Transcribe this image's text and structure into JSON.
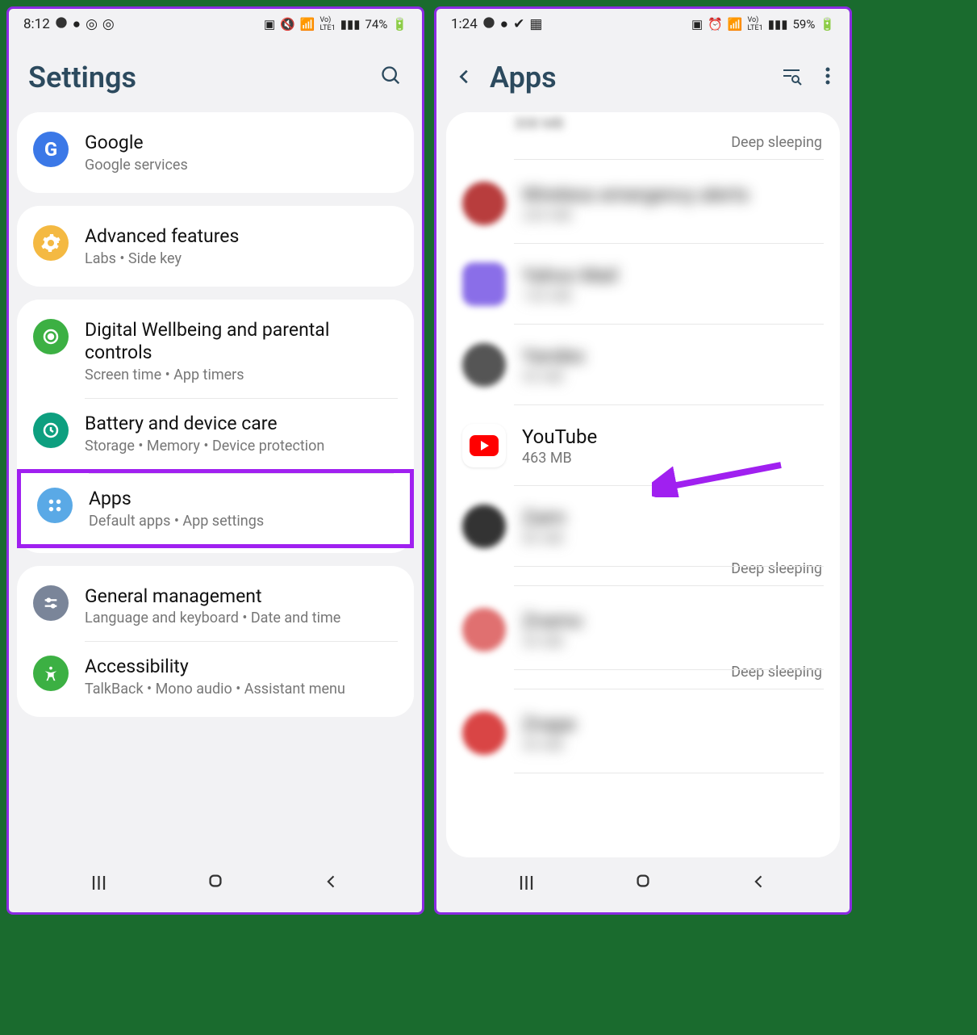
{
  "left": {
    "status": {
      "time": "8:12",
      "battery": "74%"
    },
    "title": "Settings",
    "groups": [
      {
        "items": [
          {
            "icon": "G",
            "title": "Google",
            "sub": "Google services"
          }
        ]
      },
      {
        "items": [
          {
            "icon": "gear",
            "title": "Advanced features",
            "sub": "Labs  •  Side key"
          }
        ]
      },
      {
        "items": [
          {
            "icon": "circle",
            "title": "Digital Wellbeing and parental controls",
            "sub": "Screen time  •  App timers"
          },
          {
            "icon": "heart",
            "title": "Battery and device care",
            "sub": "Storage  •  Memory  •  Device protection"
          },
          {
            "icon": "grid",
            "title": "Apps",
            "sub": "Default apps  •  App settings",
            "highlight": true
          }
        ]
      },
      {
        "items": [
          {
            "icon": "sliders",
            "title": "General management",
            "sub": "Language and keyboard  •  Date and time"
          },
          {
            "icon": "person",
            "title": "Accessibility",
            "sub": "TalkBack  •  Mono audio  •  Assistant menu"
          }
        ]
      }
    ]
  },
  "right": {
    "status": {
      "time": "1:24",
      "battery": "59%"
    },
    "title": "Apps",
    "partial_top": "308 MB",
    "deep_sleeping_label": "Deep sleeping",
    "apps": [
      {
        "title": "Wireless emergency alerts",
        "sub": "blur",
        "icon_color": "#b83d3d",
        "blur": true
      },
      {
        "title": "Yahoo Mail",
        "sub": "blur",
        "icon_color": "#8a6ee8",
        "blur": true
      },
      {
        "title": "Yandex",
        "sub": "blur",
        "icon_color": "#555",
        "blur": true
      },
      {
        "title": "YouTube",
        "sub": "463 MB",
        "icon": "youtube",
        "blur": false,
        "arrow": true
      },
      {
        "title": "Zaim",
        "sub": "blur",
        "icon_color": "#333",
        "blur": true,
        "deep_sleep_after": true
      },
      {
        "title": "Znamo",
        "sub": "blur",
        "icon_color": "#e07070",
        "blur": true,
        "deep_sleep_after": true
      },
      {
        "title": "Znape",
        "sub": "blur",
        "icon_color": "#d94545",
        "blur": true
      }
    ]
  }
}
